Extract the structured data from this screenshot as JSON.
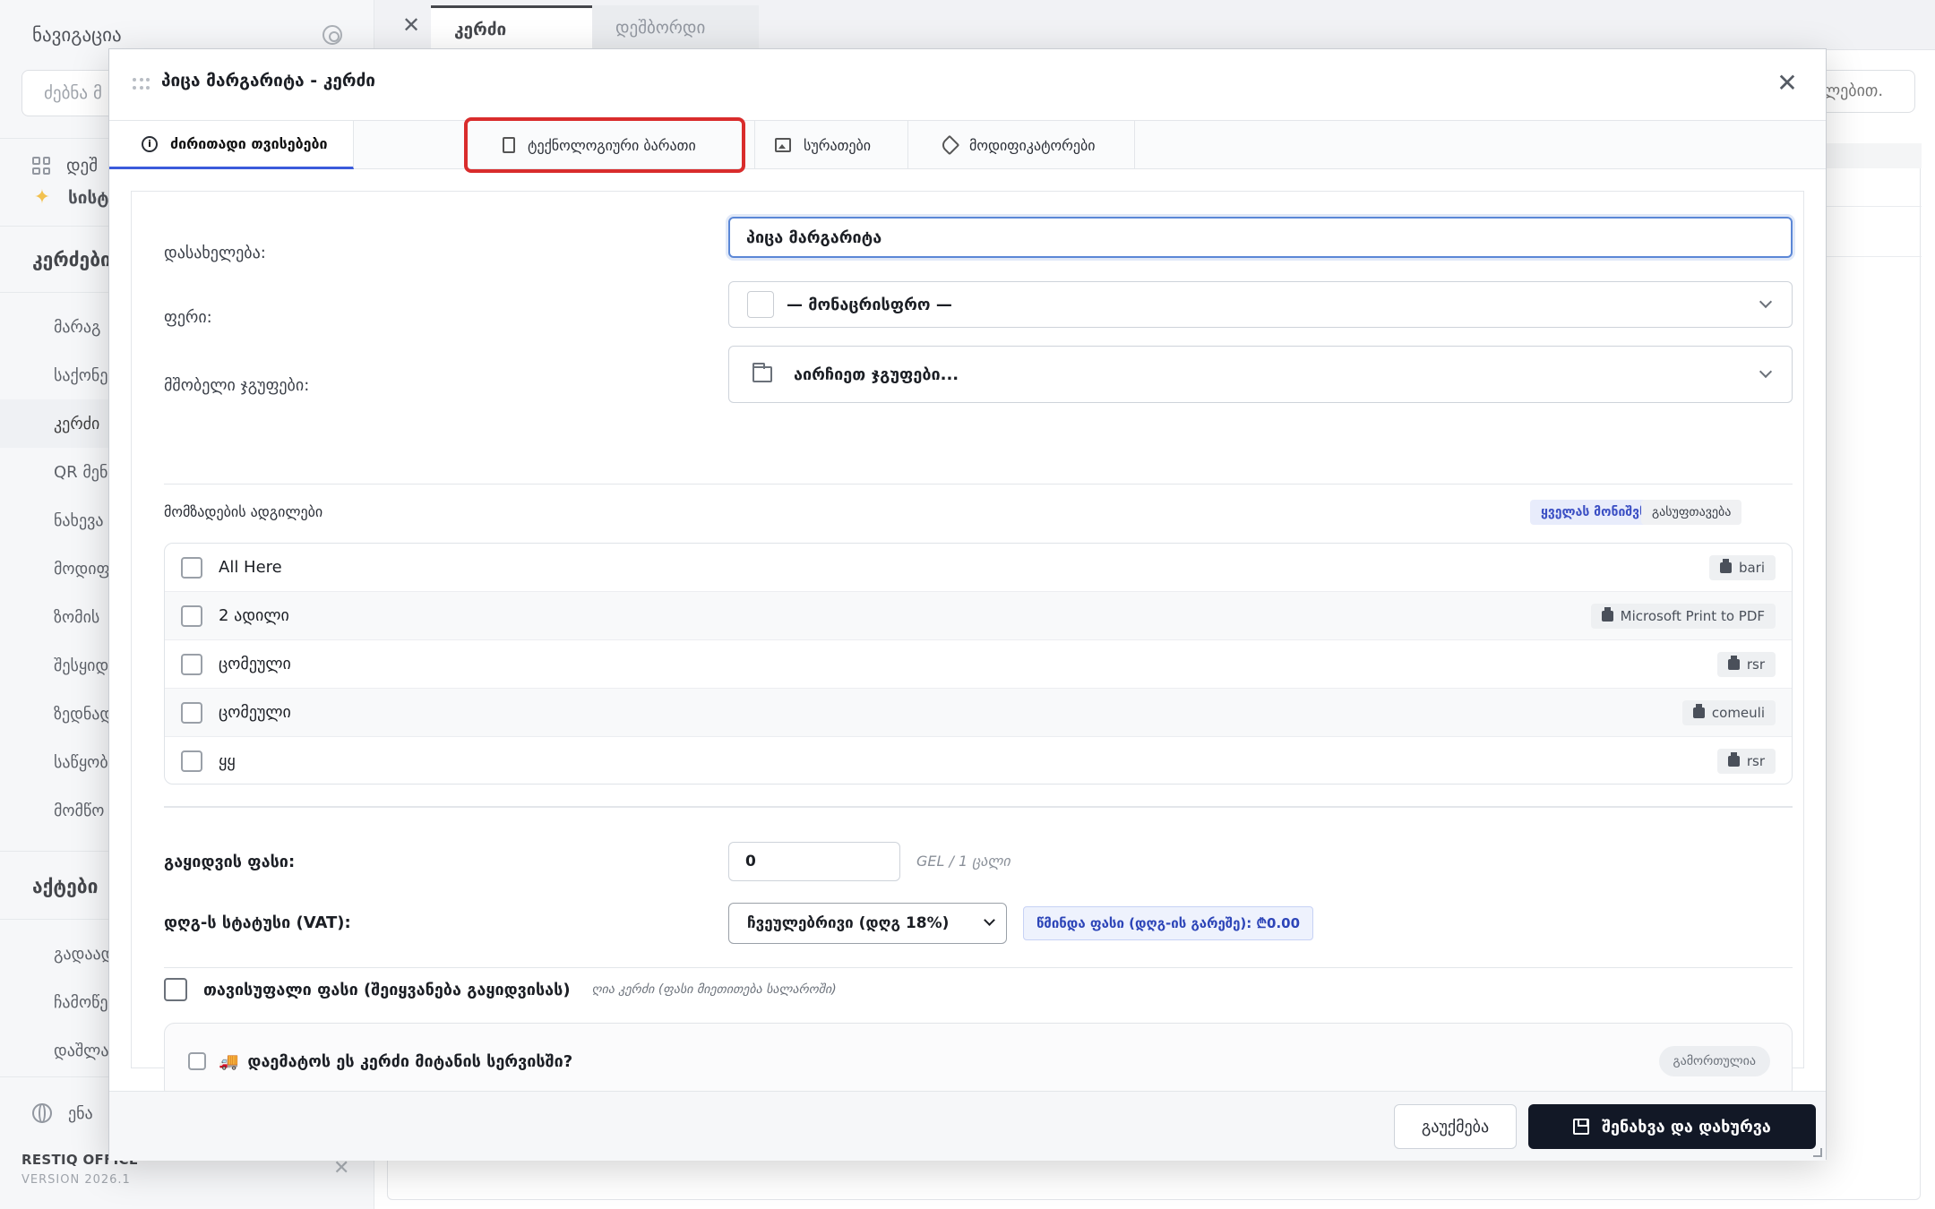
{
  "sidebar": {
    "title": "ნავიგაცია",
    "search_placeholder": "ძებნა მ",
    "quick": [
      "დეშ",
      "სისტ"
    ],
    "sections": [
      "კერძები",
      "აქტები"
    ],
    "items_dishes": [
      "მარაგ",
      "საქონე",
      "კერძი",
      "QR მენ",
      "ნახევა",
      "მოდიფ",
      "ზომის",
      "შესყიდ",
      "ზედნად",
      "საწყობ",
      "მომწო"
    ],
    "items_acts": [
      "გადაად",
      "ჩამოწე",
      "დაშლა"
    ],
    "language": "ენა",
    "brand": "RESTIQ OFFICE",
    "version": "VERSION 2026.1"
  },
  "tabbar": {
    "tabs": [
      "კერძი",
      "დეშბორდი"
    ]
  },
  "background": {
    "search_value": "ლებით."
  },
  "modal": {
    "title": "პიცა მარგარიტა - კერძი",
    "tabs": [
      "ძირითადი თვისებები",
      "ტექნოლოგიური ბარათი",
      "სურათები",
      "მოდიფიკატორები"
    ],
    "name_label": "დასახელება:",
    "name_value": "პიცა მარგარიტა",
    "color_label": "ფერი:",
    "color_value": "— მონაცრისფრო —",
    "parent_label": "მშობელი ჯგუფები:",
    "parent_value": "აირჩიეთ ჯგუფები...",
    "locations_title": "მომზადების ადგილები",
    "select_all": "ყველას მონიშვნა",
    "clear": "გასუფთავება",
    "locations": [
      {
        "name": "All Here",
        "printer": "bari"
      },
      {
        "name": "2 ადილი",
        "printer": "Microsoft Print to PDF"
      },
      {
        "name": "ცომეული",
        "printer": "rsr"
      },
      {
        "name": "ცომეული",
        "printer": "comeuli"
      },
      {
        "name": "ყყ",
        "printer": "rsr"
      }
    ],
    "price_label": "გაყიდვის ფასი:",
    "price_value": "0",
    "price_unit": "GEL / 1 ცალი",
    "vat_label": "დღგ-ს სტატუსი (VAT):",
    "vat_value": "ჩვეულებრივი (დღგ 18%)",
    "net_price": "წმინდა ფასი (დღგ-ის გარეშე): ₾0.00",
    "free_label": "თავისუფალი ფასი (შეიყვანება გაყიდვისას)",
    "free_hint": "ღია კერძი (ფასი მიეთითება სალაროში)",
    "delivery_label": "დაემატოს ეს კერძი მიტანის სერვისში?",
    "delivery_badge": "გამორთულია",
    "cancel": "გაუქმება",
    "save": "შენახვა და დახურვა"
  }
}
